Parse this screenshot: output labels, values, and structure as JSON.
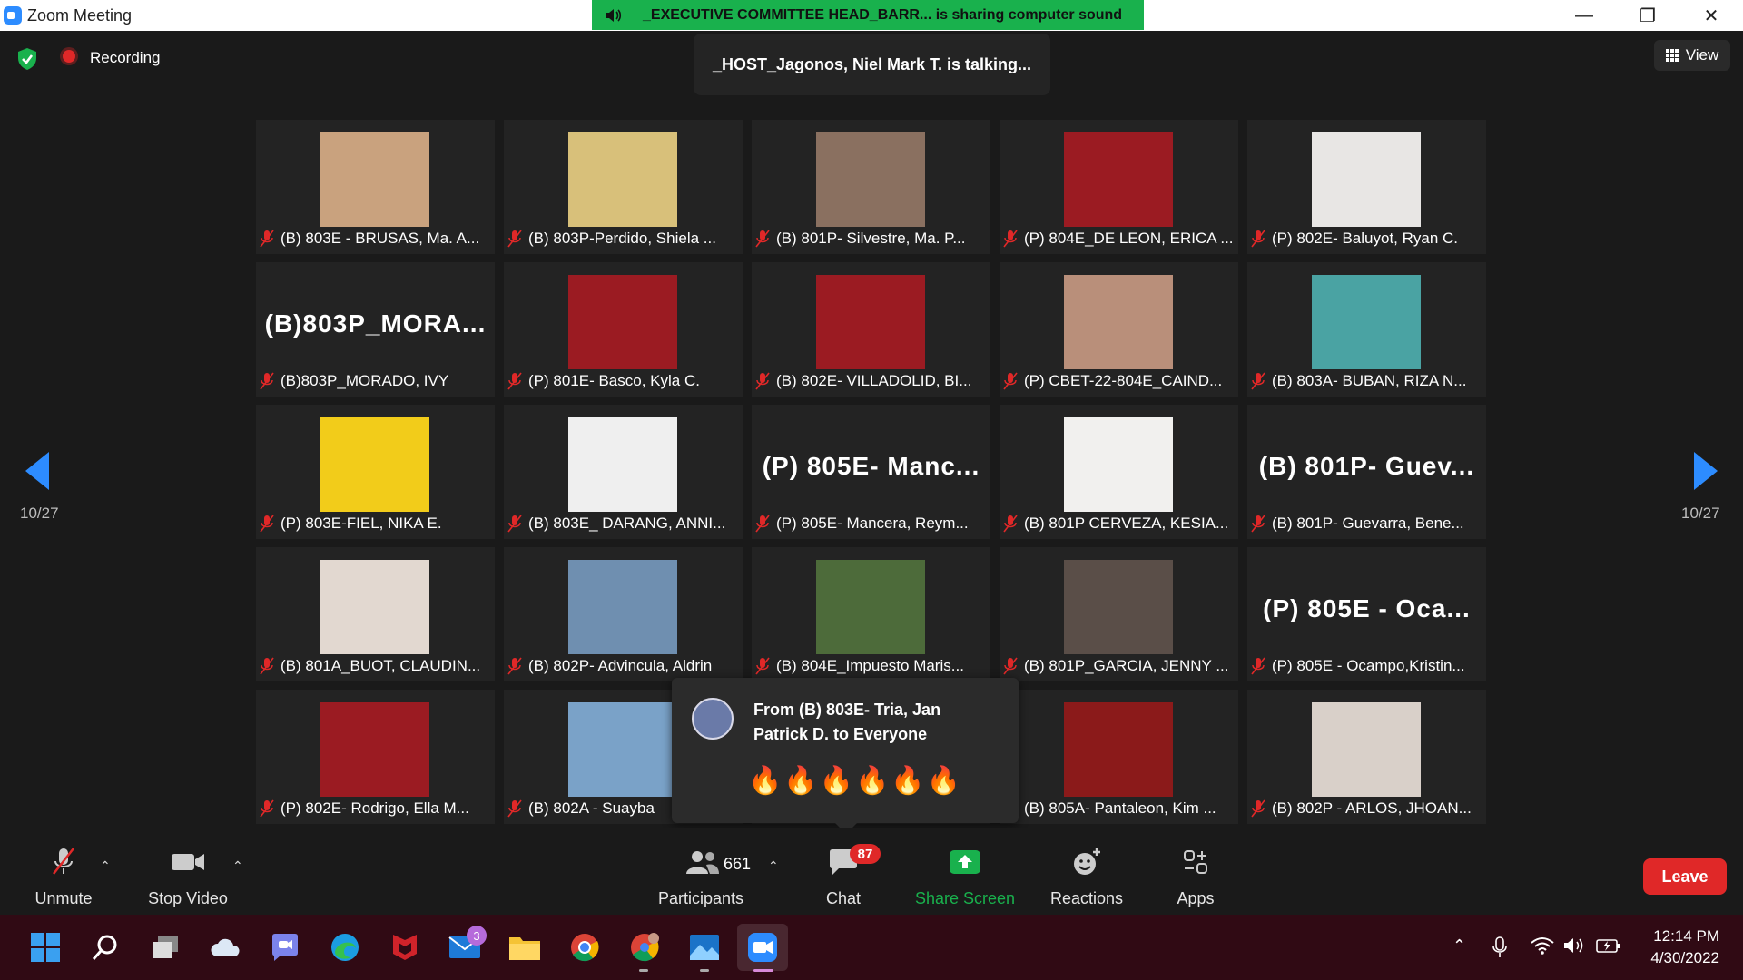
{
  "window": {
    "title": "Zoom Meeting"
  },
  "share_banner": "_EXECUTIVE COMMITTEE HEAD_BARR... is sharing computer sound",
  "recording_label": "Recording",
  "talking_indicator": "_HOST_Jagonos, Niel Mark T. is talking...",
  "view_label": "View",
  "page": {
    "left": "10/27",
    "right": "10/27"
  },
  "tiles": [
    {
      "caption": "(B) 803E - BRUSAS, Ma. A...",
      "big": "",
      "photo": "#c9a27e"
    },
    {
      "caption": "(B) 803P-Perdido, Shiela ...",
      "big": "",
      "photo": "#d8c07a"
    },
    {
      "caption": "(B) 801P- Silvestre, Ma. P...",
      "big": "",
      "photo": "#8a7060"
    },
    {
      "caption": "(P) 804E_DE LEON, ERICA ...",
      "big": "",
      "photo": "#9b1b22"
    },
    {
      "caption": "(P) 802E- Baluyot, Ryan C.",
      "big": "",
      "photo": "#e8e6e4"
    },
    {
      "caption": "(B)803P_MORADO, IVY",
      "big": "(B)803P_MORA...",
      "photo": ""
    },
    {
      "caption": "(P) 801E- Basco, Kyla C.",
      "big": "",
      "photo": "#9b1b22"
    },
    {
      "caption": "(B) 802E- VILLADOLID, BI...",
      "big": "",
      "photo": "#9b1b22"
    },
    {
      "caption": "(P) CBET-22-804E_CAIND...",
      "big": "",
      "photo": "#b98f7a"
    },
    {
      "caption": "(B) 803A- BUBAN, RIZA N...",
      "big": "",
      "photo": "#4aa3a3"
    },
    {
      "caption": "(P) 803E-FIEL, NIKA E.",
      "big": "",
      "photo": "#f2cc1a"
    },
    {
      "caption": "(B) 803E_ DARANG, ANNI...",
      "big": "",
      "photo": "#efefef"
    },
    {
      "caption": "(P) 805E- Mancera, Reym...",
      "big": "(P) 805E- Manc...",
      "photo": ""
    },
    {
      "caption": "(B) 801P CERVEZA, KESIA...",
      "big": "",
      "photo": "#f1f0ee"
    },
    {
      "caption": "(B) 801P- Guevarra, Bene...",
      "big": "(B) 801P- Guev...",
      "photo": ""
    },
    {
      "caption": "(B) 801A_BUOT, CLAUDIN...",
      "big": "",
      "photo": "#e2d8d0"
    },
    {
      "caption": "(B) 802P- Advincula, Aldrin",
      "big": "",
      "photo": "#6f8fb0"
    },
    {
      "caption": "(B) 804E_Impuesto Maris...",
      "big": "",
      "photo": "#4d6b3a"
    },
    {
      "caption": "(B) 801P_GARCIA, JENNY ...",
      "big": "",
      "photo": "#5a4e48"
    },
    {
      "caption": "(P) 805E - Ocampo,Kristin...",
      "big": "(P) 805E - Oca...",
      "photo": ""
    },
    {
      "caption": "(P) 802E- Rodrigo, Ella M...",
      "big": "",
      "photo": "#9b1b22"
    },
    {
      "caption": "(B) 802A - Suayba",
      "big": "",
      "photo": "#7aa2c8"
    },
    {
      "caption": "",
      "big": "",
      "photo": ""
    },
    {
      "caption": "(B) 805A- Pantaleon, Kim ...",
      "big": "",
      "photo": "#8b1a1a"
    },
    {
      "caption": "(B) 802P - ARLOS, JHOAN...",
      "big": "",
      "photo": "#d9d0c9"
    }
  ],
  "chat_popup": {
    "from": "From (B) 803E- Tria, Jan Patrick D. to Everyone",
    "message": "🔥🔥🔥🔥🔥🔥"
  },
  "toolbar": {
    "unmute": "Unmute",
    "stop_video": "Stop Video",
    "participants": "Participants",
    "participant_count": "661",
    "chat": "Chat",
    "chat_badge": "87",
    "share_screen": "Share Screen",
    "reactions": "Reactions",
    "apps": "Apps",
    "leave": "Leave"
  },
  "taskbar": {
    "mail_badge": "3",
    "time": "12:14 PM",
    "date": "4/30/2022"
  },
  "colors": {
    "accent": "#2d8cff",
    "share_green": "#19b14d",
    "leave_red": "#e02828",
    "taskbar": "#300a14"
  }
}
